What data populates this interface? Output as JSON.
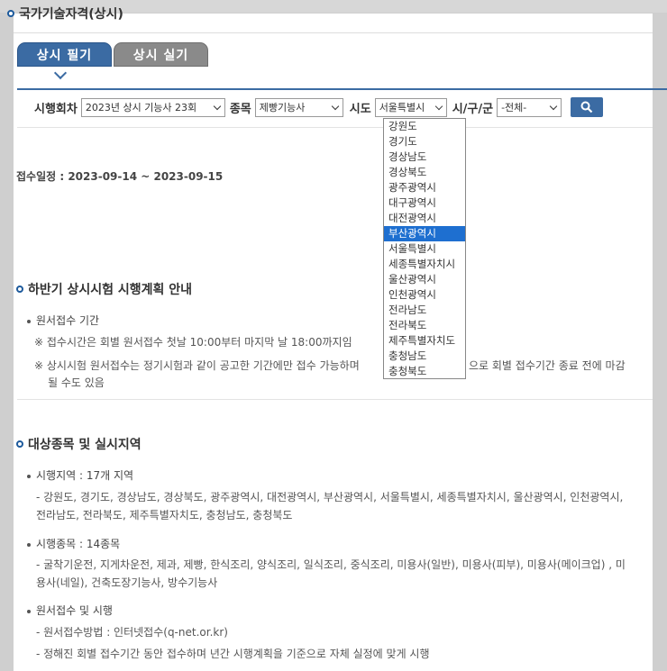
{
  "page_title": "국가기술자격(상시)",
  "tabs": [
    {
      "label": "상시 필기"
    },
    {
      "label": "상시 실기"
    }
  ],
  "filter": {
    "round_label": "시행회차",
    "round_value": "2023년 상시 기능사 23회",
    "item_label": "종목",
    "item_value": "제빵기능사",
    "region_label": "시도",
    "region_value": "서울특별시",
    "district_label": "시/구/군",
    "district_value": "-전체-"
  },
  "region_options": [
    "강원도",
    "경기도",
    "경상남도",
    "경상북도",
    "광주광역시",
    "대구광역시",
    "대전광역시",
    "부산광역시",
    "서울특별시",
    "세종특별자치시",
    "울산광역시",
    "인천광역시",
    "전라남도",
    "전라북도",
    "제주특별자치도",
    "충청남도",
    "충청북도"
  ],
  "highlighted_option": "부산광역시",
  "schedule": "접수일정 : 2023-09-14 ~ 2023-09-15",
  "section1": {
    "title": "하반기 상시시험 시행계획 안내",
    "item": "원서접수 기간",
    "note1": "※ 접수시간은 회별 원서접수 첫날 10:00부터 마지막 날 18:00까지임",
    "note2a": "※ 상시시험 원서접수는 정기시험과 같이 공고한 기간에만 접수 가능하며",
    "note2b": "으로 회별 접수기간 종료 전에 마감",
    "note2c": "될 수도 있음"
  },
  "section2": {
    "title": "대상종목 및 실시지역",
    "item1": "시행지역 : 17개 지역",
    "item1_detail": "- 강원도, 경기도, 경상남도, 경상북도, 광주광역시, 대전광역시, 부산광역시, 서울특별시, 세종특별자치시, 울산광역시, 인천광역시, 전라남도, 전라북도, 제주특별자치도, 충청남도, 충청북도",
    "item2": "시행종목 : 14종목",
    "item2_detail": "- 굴착기운전, 지게차운전, 제과, 제빵, 한식조리, 양식조리, 일식조리, 중식조리, 미용사(일반), 미용사(피부), 미용사(메이크업) , 미용사(네일), 건축도장기능사, 방수기능사",
    "item3": "원서접수 및 시행",
    "item3_detail1": "- 원서접수방법 : 인터넷접수(q-net.or.kr)",
    "item3_detail2": "- 정해진 회별 접수기간 동안 접수하며 년간 시행계획을 기준으로 자체 실정에 맞게 시행"
  }
}
